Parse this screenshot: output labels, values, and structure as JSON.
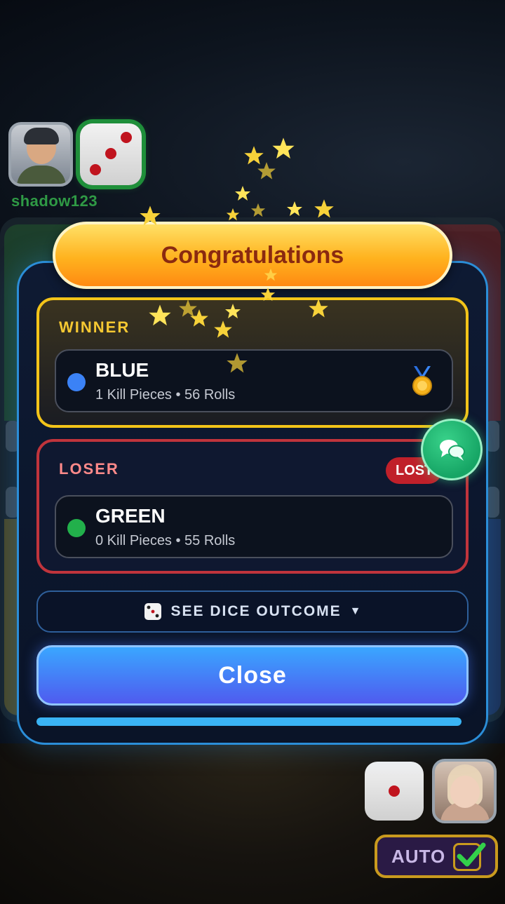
{
  "players": {
    "top": {
      "name": "shadow123",
      "dice_value": 3
    },
    "bottom": {
      "dice_value": 1
    }
  },
  "auto_button": {
    "label": "AUTO",
    "checked": true
  },
  "modal": {
    "title": "Congratulations",
    "winner": {
      "label": "WINNER",
      "team": "BLUE",
      "color": "#3b82f6",
      "stats": "1 Kill Pieces • 56 Rolls",
      "medal_icon": "medal-icon"
    },
    "loser": {
      "label": "LOSER",
      "badge": "LOST",
      "team": "GREEN",
      "color": "#22b04b",
      "stats": "0 Kill Pieces • 55 Rolls"
    },
    "dice_outcome": {
      "icon": "dice-icon",
      "label": "SEE DICE OUTCOME",
      "chevron": "▼"
    },
    "close_label": "Close",
    "progress": 1.0
  },
  "chat_button": {
    "icon": "chat-icon"
  },
  "colors": {
    "accent": "#2b8ed8",
    "winner_border": "#f3c419",
    "loser_border": "#c0343c",
    "title_text": "#8a2a10"
  }
}
